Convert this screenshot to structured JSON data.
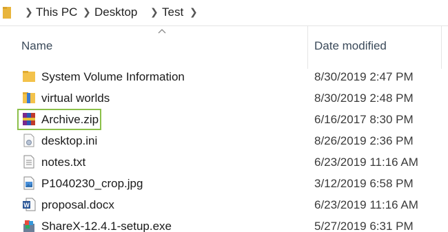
{
  "breadcrumb": {
    "items": [
      "This PC",
      "Desktop",
      "Test"
    ]
  },
  "columns": {
    "name": "Name",
    "date_modified": "Date modified"
  },
  "files": [
    {
      "name": "System Volume Information",
      "date": "8/30/2019 2:47 PM",
      "icon": "folder-icon"
    },
    {
      "name": "virtual worlds",
      "date": "8/30/2019 2:48 PM",
      "icon": "folder-icon"
    },
    {
      "name": "Archive.zip",
      "date": "6/16/2017 8:30 PM",
      "icon": "winrar-archive-icon"
    },
    {
      "name": "desktop.ini",
      "date": "8/26/2019 2:36 PM",
      "icon": "settings-file-icon"
    },
    {
      "name": "notes.txt",
      "date": "6/23/2019 11:16 AM",
      "icon": "text-file-icon"
    },
    {
      "name": "P1040230_crop.jpg",
      "date": "3/12/2019 6:58 PM",
      "icon": "image-file-icon"
    },
    {
      "name": "proposal.docx",
      "date": "6/23/2019 11:16 AM",
      "icon": "word-document-icon"
    },
    {
      "name": "ShareX-12.4.1-setup.exe",
      "date": "5/27/2019 6:31 PM",
      "icon": "installer-icon"
    }
  ],
  "colors": {
    "highlight_border": "#8cc04a",
    "folder": "#f3c24b"
  }
}
